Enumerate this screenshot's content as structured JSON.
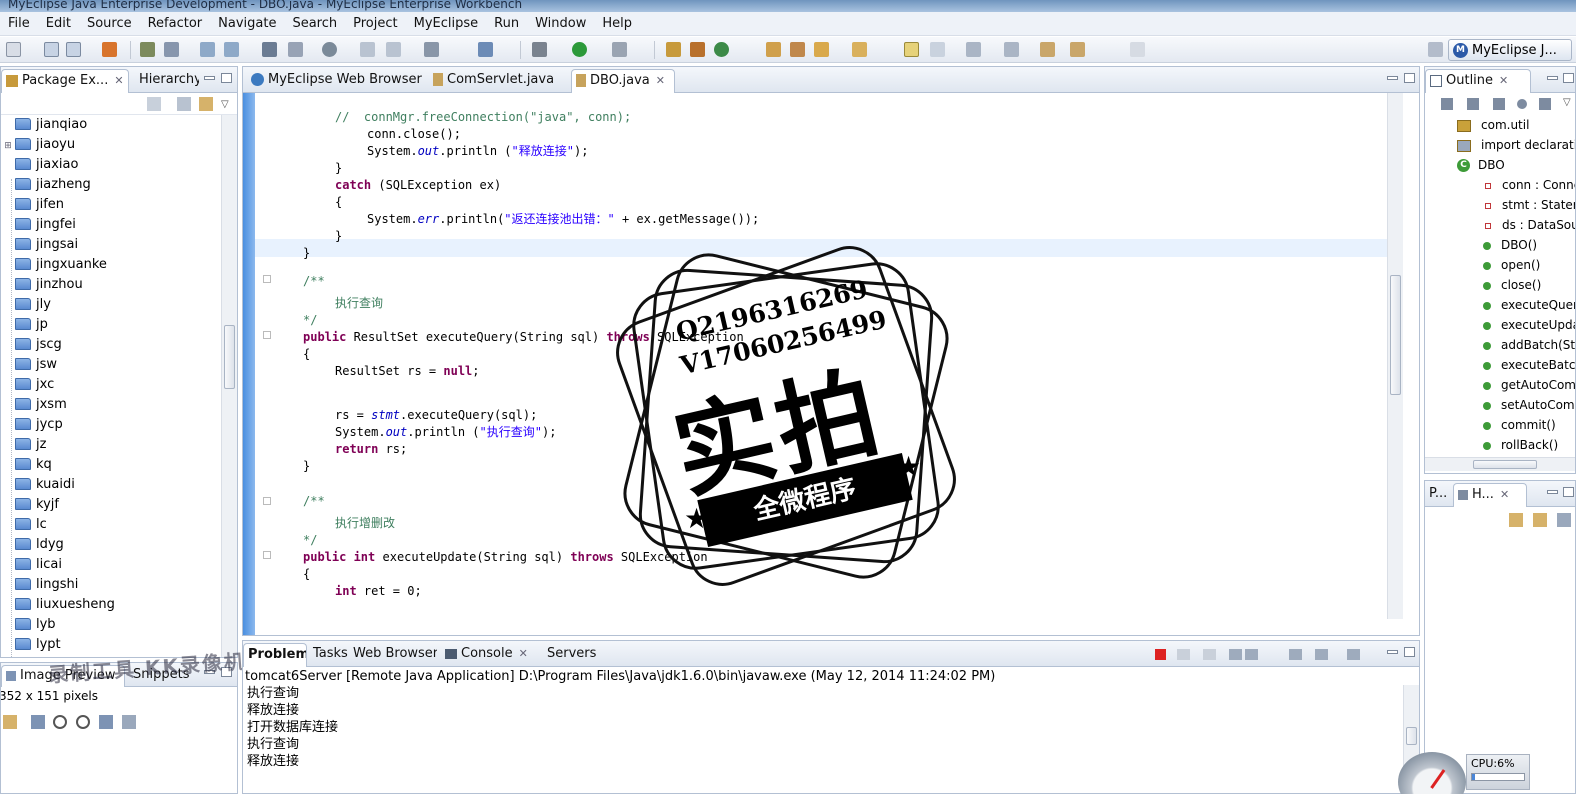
{
  "window": {
    "title": "MyEclipse Java Enterprise Development - DBO.java - MyEclipse Enterprise Workbench"
  },
  "menu": [
    "File",
    "Edit",
    "Source",
    "Refactor",
    "Navigate",
    "Search",
    "Project",
    "MyEclipse",
    "Run",
    "Window",
    "Help"
  ],
  "perspective": {
    "label": "MyEclipse J..."
  },
  "package_explorer": {
    "tabs": [
      {
        "label": "Package Ex..."
      },
      {
        "label": "Hierarchy"
      }
    ],
    "items": [
      "jianqiao",
      "jiaoyu",
      "jiaxiao",
      "jiazheng",
      "jifen",
      "jingfei",
      "jingsai",
      "jingxuanke",
      "jinzhou",
      "jly",
      "jp",
      "jscg",
      "jsw",
      "jxc",
      "jxsm",
      "jycp",
      "jz",
      "kq",
      "kuaidi",
      "kyjf",
      "lc",
      "ldyg",
      "licai",
      "lingshi",
      "liuxuesheng",
      "lyb",
      "lypt"
    ]
  },
  "editor": {
    "tabs": [
      {
        "label": "MyEclipse Web Browser"
      },
      {
        "label": "ComServlet.java"
      },
      {
        "label": "DBO.java"
      }
    ],
    "code": {
      "l1_comment": "//  connMgr.freeConnection(\"java\", conn);",
      "l2": "conn.close();",
      "l3_a": "System.",
      "l3_b": "out",
      "l3_c": ".println (",
      "l3_str": "\"释放连接\"",
      "l3_d": ");",
      "l4": "}",
      "l5_kw": "catch",
      "l5_rest": " (SQLException ex)",
      "l6": "{",
      "l7_a": "System.",
      "l7_b": "err",
      "l7_c": ".println(",
      "l7_str": "\"返还连接池出错：\"",
      "l7_d": " + ex.getMessage());",
      "l8": "}",
      "l9": "}",
      "l10": "/**",
      "l11": "执行查询",
      "l12": "*/",
      "l13_kw": "public",
      "l13_a": " ResultSet executeQuery(String sql) ",
      "l13_kw2": "throws",
      "l13_b": " SQLException",
      "l14": "{",
      "l15_a": "ResultSet rs = ",
      "l15_kw": "null",
      "l15_b": ";",
      "l16_a": "rs = ",
      "l16_b": "stmt",
      "l16_c": ".executeQuery(sql);",
      "l17_a": "System.",
      "l17_b": "out",
      "l17_c": ".println (",
      "l17_str": "\"执行查询\"",
      "l17_d": ");",
      "l18_kw": "return",
      "l18_rest": " rs;",
      "l19": "}",
      "l20": "/**",
      "l21": "执行增删改",
      "l22": "*/",
      "l23_kw": "public",
      "l23_kw2": " int",
      "l23_a": " executeUpdate(String sql) ",
      "l23_kw3": "throws",
      "l23_b": " SQLException",
      "l24": "{",
      "l25_kw": "int",
      "l25_rest": " ret = 0;"
    }
  },
  "outline": {
    "tab": "Outline",
    "items": [
      "com.util",
      "import declarations",
      "DBO",
      "conn : Connection",
      "stmt : Statement",
      "ds : DataSource",
      "DBO()",
      "open()",
      "close()",
      "executeQuery(String)",
      "executeUpdate(String)",
      "addBatch(String)",
      "executeBatch()",
      "getAutoCommit()",
      "setAutoCommit(boolean)",
      "commit()",
      "rollBack()"
    ]
  },
  "secondary_tabs": {
    "left_label": "P...",
    "right_label": "H..."
  },
  "image_preview": {
    "tabs": [
      "Image Preview",
      "Snippets"
    ],
    "info": "352 x 151 pixels"
  },
  "bottom_panel": {
    "tabs": [
      "Problems",
      "Tasks",
      "Web Browser",
      "Console",
      "Servers"
    ],
    "console_header": "tomcat6Server [Remote Java Application] D:\\Program Files\\Java\\jdk1.6.0\\bin\\javaw.exe (May 12, 2014 11:24:02 PM)",
    "console_lines": [
      "执行查询",
      "释放连接",
      "打开数据库连接",
      "执行查询",
      "释放连接"
    ]
  },
  "overlay": {
    "stamp_line1": "Q2196316269",
    "stamp_line2": "V17060256499",
    "stamp_big": "实拍",
    "stamp_ribbon": "全微程序",
    "watermark": "录制工具 KK录像机"
  },
  "cpu_meter": {
    "label": "CPU:6%",
    "value_percent": 6
  },
  "colors": {
    "keyword": "#7f0055",
    "string": "#2a00ff",
    "comment": "#3f7f5f",
    "field": "#0000c0",
    "accent": "#4a8fe0"
  },
  "icons": [
    "folder-icon",
    "close-icon",
    "minimize-icon",
    "maximize-icon",
    "method-icon",
    "field-icon",
    "package-icon",
    "class-icon",
    "stop-icon",
    "gauge-icon"
  ]
}
